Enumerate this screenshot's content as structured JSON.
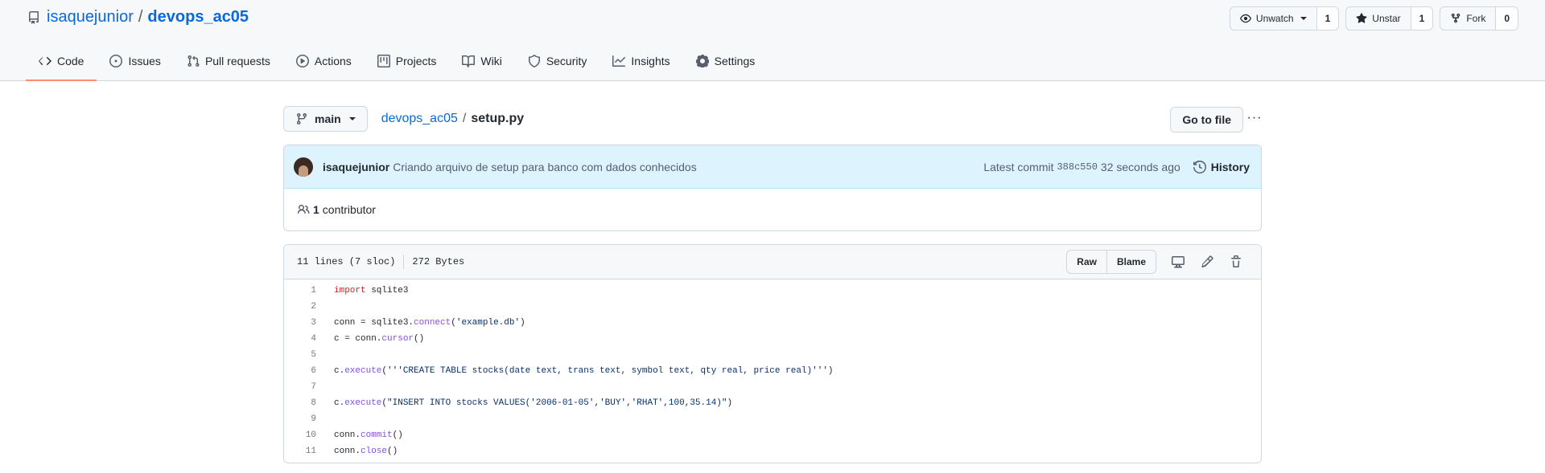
{
  "repo": {
    "owner": "isaquejunior",
    "slash": "/",
    "name": "devops_ac05"
  },
  "repo_actions": {
    "watch_label": "Unwatch",
    "watch_count": "1",
    "star_label": "Unstar",
    "star_count": "1",
    "fork_label": "Fork",
    "fork_count": "0"
  },
  "tabs": [
    {
      "label": "Code",
      "icon": "code-icon",
      "active": true
    },
    {
      "label": "Issues",
      "icon": "issue-icon"
    },
    {
      "label": "Pull requests",
      "icon": "pull-request-icon"
    },
    {
      "label": "Actions",
      "icon": "play-icon"
    },
    {
      "label": "Projects",
      "icon": "project-icon"
    },
    {
      "label": "Wiki",
      "icon": "book-icon"
    },
    {
      "label": "Security",
      "icon": "shield-icon"
    },
    {
      "label": "Insights",
      "icon": "graph-icon"
    },
    {
      "label": "Settings",
      "icon": "gear-icon"
    }
  ],
  "file_nav": {
    "branch": "main",
    "repo_link": "devops_ac05",
    "separator": "/",
    "file_name": "setup.py",
    "go_to_file": "Go to file",
    "more": "···"
  },
  "commit": {
    "author": "isaquejunior",
    "message": "Criando arquivo de setup para banco com dados conhecidos",
    "latest_label": "Latest commit",
    "sha": "388c550",
    "time": "32 seconds ago",
    "history_label": "History"
  },
  "contributors": {
    "count": "1",
    "label": "contributor"
  },
  "file_info": {
    "lines": "11 lines (7 sloc)",
    "size": "272 Bytes",
    "raw_label": "Raw",
    "blame_label": "Blame"
  },
  "code_lines": [
    "import sqlite3",
    "",
    "conn = sqlite3.connect('example.db')",
    "c = conn.cursor()",
    "",
    "c.execute('''CREATE TABLE stocks(date text, trans text, symbol text, qty real, price real)''')",
    "",
    "c.execute(\"INSERT INTO stocks VALUES('2006-01-05','BUY','RHAT',100,35.14)\")",
    "",
    "conn.commit()",
    "conn.close()"
  ],
  "colors": {
    "accent_link": "#0969da",
    "tab_underline": "#fd8c73",
    "commit_bar_bg": "#ddf4ff",
    "keyword": "#cf222e",
    "function": "#8250df",
    "string": "#0a3069"
  }
}
